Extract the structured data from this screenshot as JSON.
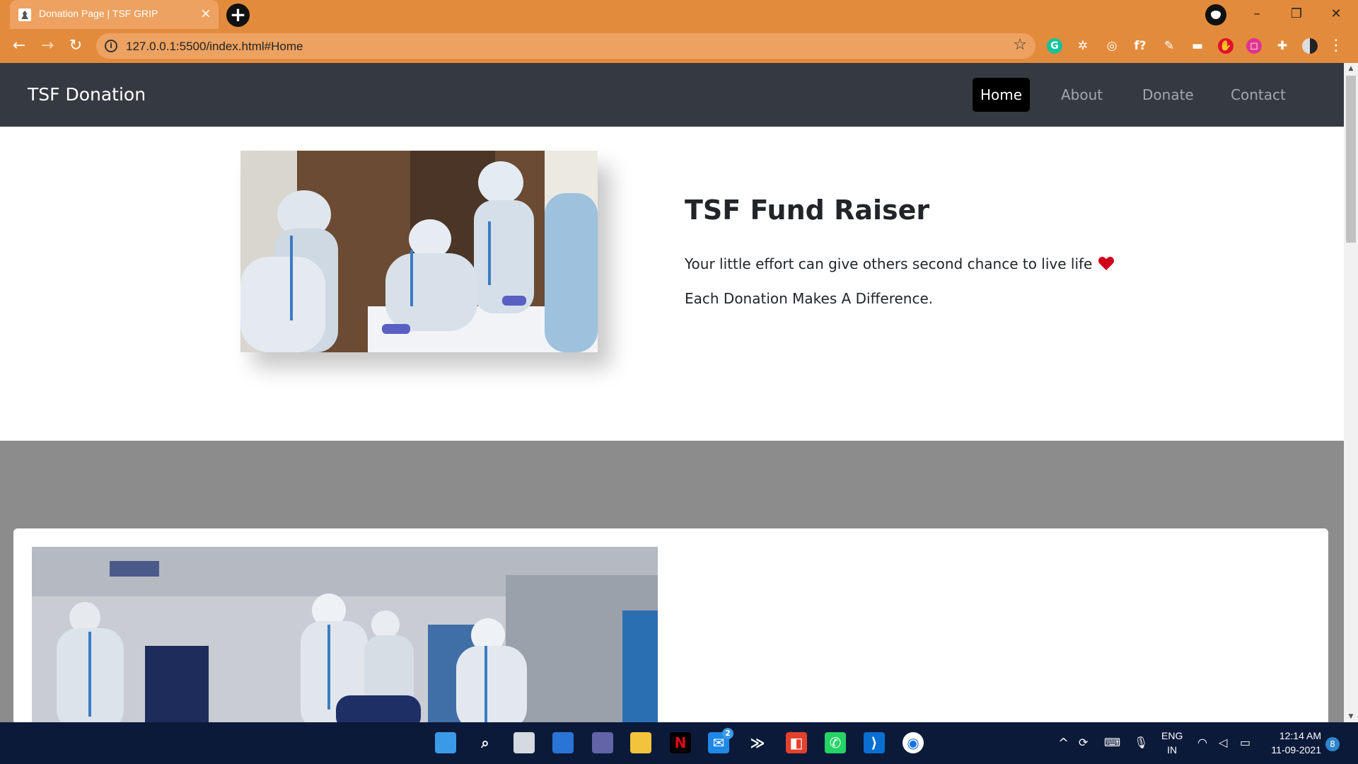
{
  "browser": {
    "tab_title": "Donation Page | TSF GRIP",
    "tab_close": "×",
    "new_tab": "+",
    "url": "127.0.0.1:5500/index.html#Home",
    "info_glyph": "i",
    "star_glyph": "☆",
    "back_glyph": "←",
    "forward_glyph": "→",
    "reload_glyph": "↻",
    "minimize": "–",
    "restore": "❐",
    "close": "✕",
    "menu": "⋮",
    "accent_color": "#e38b3c",
    "extensions": [
      {
        "icon": "grammarly-icon",
        "glyph": "G",
        "color": "#15c39a"
      },
      {
        "icon": "react-devtools-icon",
        "glyph": "✲",
        "color": "#e38b3c"
      },
      {
        "icon": "target-icon",
        "glyph": "◎",
        "color": "#e38b3c"
      },
      {
        "icon": "fonts-ninja-icon",
        "glyph": "f?",
        "color": "#e38b3c"
      },
      {
        "icon": "color-picker-icon",
        "glyph": "✎",
        "color": "#e38b3c"
      },
      {
        "icon": "glasses-icon",
        "glyph": "▬",
        "color": "#e38b3c"
      },
      {
        "icon": "adblock-icon",
        "glyph": "✋",
        "color": "#e0102a"
      },
      {
        "icon": "tagassistant-icon",
        "glyph": "◻",
        "color": "#e0358f"
      },
      {
        "icon": "extensions-puzzle-icon",
        "glyph": "✚",
        "color": "#e38b3c"
      }
    ]
  },
  "site": {
    "brand": "TSF Donation",
    "nav": [
      {
        "label": "Home",
        "active": true
      },
      {
        "label": "About",
        "active": false
      },
      {
        "label": "Donate",
        "active": false
      },
      {
        "label": "Contact",
        "active": false
      }
    ],
    "hero": {
      "title": "TSF Fund Raiser",
      "line1": "Your little effort can give others second chance to live life",
      "line2": "Each Donation Makes A Difference."
    },
    "colors": {
      "navbar": "#343a40",
      "section": "#8c8c8c",
      "heart": "#d0021b"
    }
  },
  "taskbar": {
    "apps": [
      "windows-start-icon",
      "search-icon",
      "task-view-icon",
      "widgets-icon",
      "teams-chat-icon",
      "file-explorer-icon",
      "netflix-icon",
      "mail-icon",
      "vscode-insiders-icon",
      "office-icon",
      "whatsapp-icon",
      "vscode-icon",
      "chrome-icon"
    ],
    "mail_badge": "2",
    "tray_chevron": "^",
    "lang_line1": "ENG",
    "lang_line2": "IN",
    "time": "12:14 AM",
    "date": "11-09-2021",
    "notification_count": "8"
  }
}
